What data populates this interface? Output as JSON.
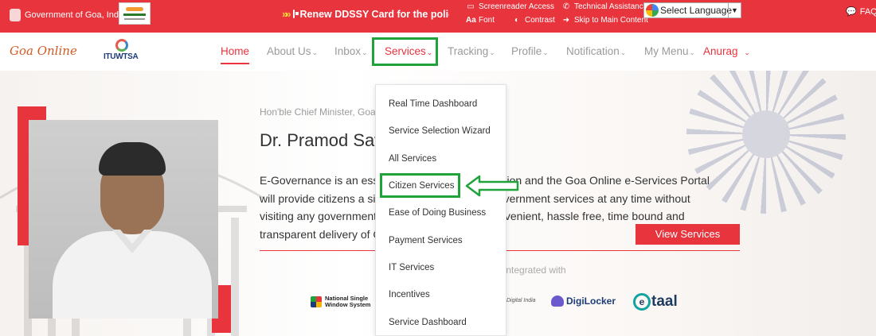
{
  "topbar": {
    "gov_label": "Government of Goa, India",
    "ticker_text": "Renew DDSSY Card for the policy",
    "screenreader": "Screenreader Access",
    "technical": "Technical Assistance",
    "font": "Font",
    "contrast": "Contrast",
    "skip": "Skip to Main Content",
    "font_icon": "Aa",
    "language_select": "Select Language",
    "faq": "FAQ"
  },
  "nav": {
    "logo": "Goa Online",
    "itu_logo": "ITUWTSA",
    "items": [
      {
        "label": "Home"
      },
      {
        "label": "About Us"
      },
      {
        "label": "Inbox"
      },
      {
        "label": "Services"
      },
      {
        "label": "Tracking"
      },
      {
        "label": "Profile"
      },
      {
        "label": "Notification"
      },
      {
        "label": "My Menu"
      }
    ],
    "user": "Anurag"
  },
  "hero": {
    "cm_title": "Hon'ble Chief Minister, Goa",
    "cm_name": "Dr. Pramod Sawant",
    "description_lines": [
      "E-Governance is an essential element of this mission and the Goa Online e-Services Portal",
      "will provide citizens a single window to various government services at any time without",
      "visiting any government office. It will ensure a convenient, hassle free, time bound and",
      "transparent delivery of Government services."
    ],
    "view_services": "View Services",
    "partner_label": "Integrated with",
    "partners": {
      "nsws_line1": "National Single",
      "nsws_line2": "Window System",
      "digital_india": "Digital India",
      "digilocker": "DigiLocker",
      "etaal": "taal"
    }
  },
  "dropdown": {
    "items": [
      {
        "label": "Real Time Dashboard"
      },
      {
        "label": "Service Selection Wizard"
      },
      {
        "label": "All Services"
      },
      {
        "label": "Citizen Services"
      },
      {
        "label": "Ease of Doing Business"
      },
      {
        "label": "Payment Services"
      },
      {
        "label": "IT Services"
      },
      {
        "label": "Incentives"
      },
      {
        "label": "Service Dashboard"
      }
    ]
  },
  "colors": {
    "brand_red": "#e8343d",
    "highlight_green": "#1fa33a"
  },
  "icons": {
    "ticker": "double-arrow-icon",
    "card": "id-card-icon",
    "screenreader": "monitor-icon",
    "technical": "phone-icon",
    "contrast": "contrast-icon",
    "skip": "arrow-right-icon",
    "faq": "chat-icon"
  }
}
